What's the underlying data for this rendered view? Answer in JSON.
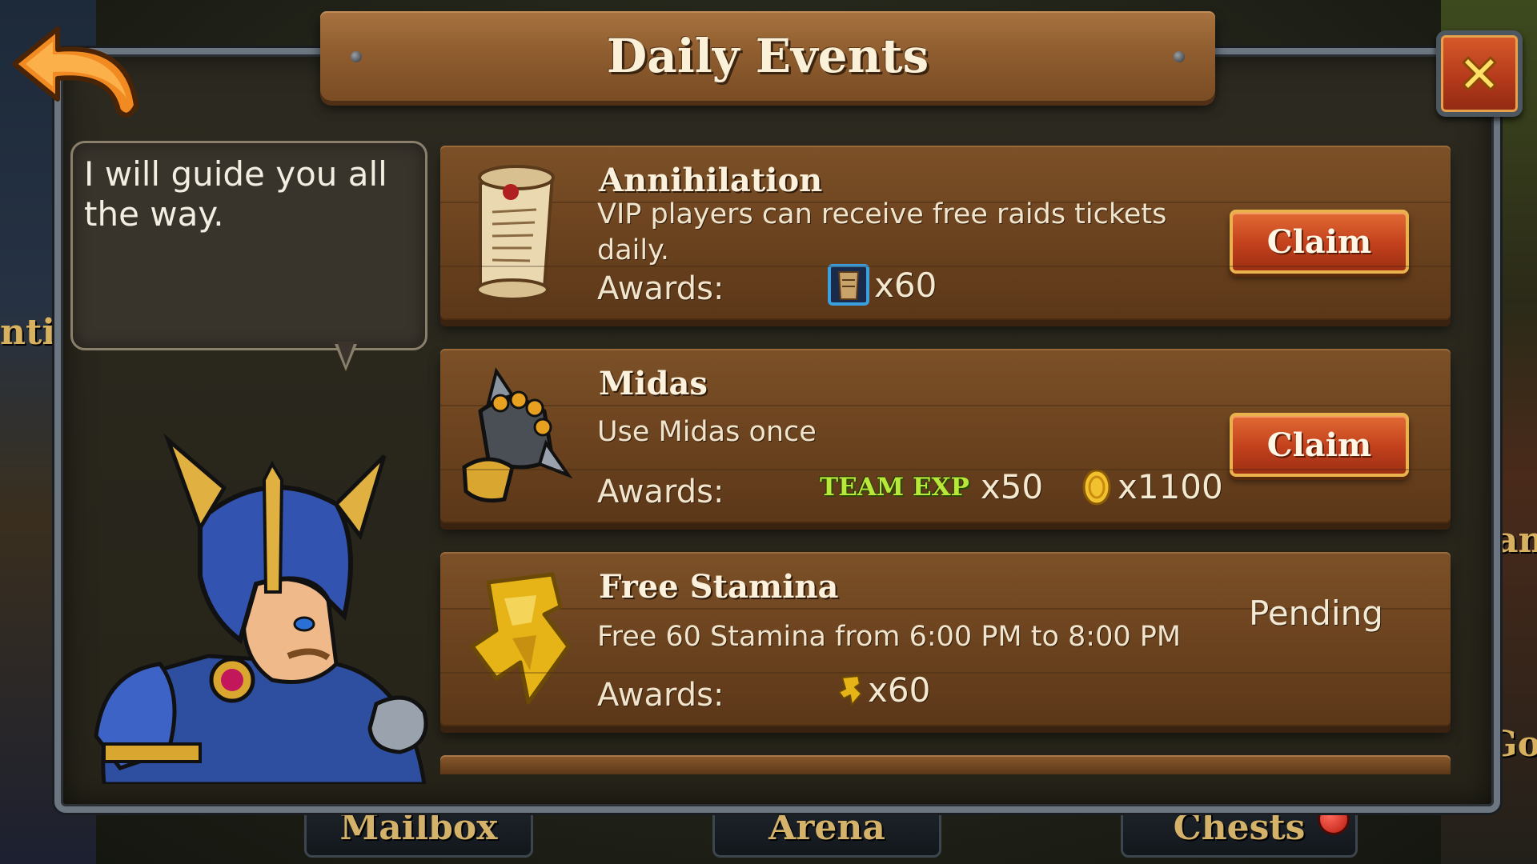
{
  "header": {
    "title": "Daily Events"
  },
  "guide": {
    "text": "I will guide you all the way."
  },
  "events": [
    {
      "title": "Annihilation",
      "description": "VIP players can receive free raids tickets daily.",
      "awards_label": "Awards:",
      "awards": [
        {
          "icon": "raid-ticket-icon",
          "amount": "x60"
        }
      ],
      "action": "Claim"
    },
    {
      "title": "Midas",
      "description": "Use Midas once",
      "awards_label": "Awards:",
      "awards": [
        {
          "icon": "team-exp-label",
          "label": "TEAM EXP",
          "amount": "x50"
        },
        {
          "icon": "gold-coin-icon",
          "amount": "x1100"
        }
      ],
      "action": "Claim"
    },
    {
      "title": "Free Stamina",
      "description": "Free 60 Stamina from 6:00 PM to 8:00 PM",
      "awards_label": "Awards:",
      "awards": [
        {
          "icon": "stamina-icon",
          "amount": "x60"
        }
      ],
      "status": "Pending"
    }
  ],
  "bottom_nav": [
    {
      "label": "Mailbox"
    },
    {
      "label": "Arena"
    },
    {
      "label": "Chests",
      "has_notification": true
    }
  ],
  "background_labels": {
    "left": "ntir",
    "right_1": "an",
    "right_2": "Go"
  },
  "colors": {
    "claim_button": "#c2401c",
    "plank": "#6c431f",
    "team_exp": "#b9e83a"
  }
}
